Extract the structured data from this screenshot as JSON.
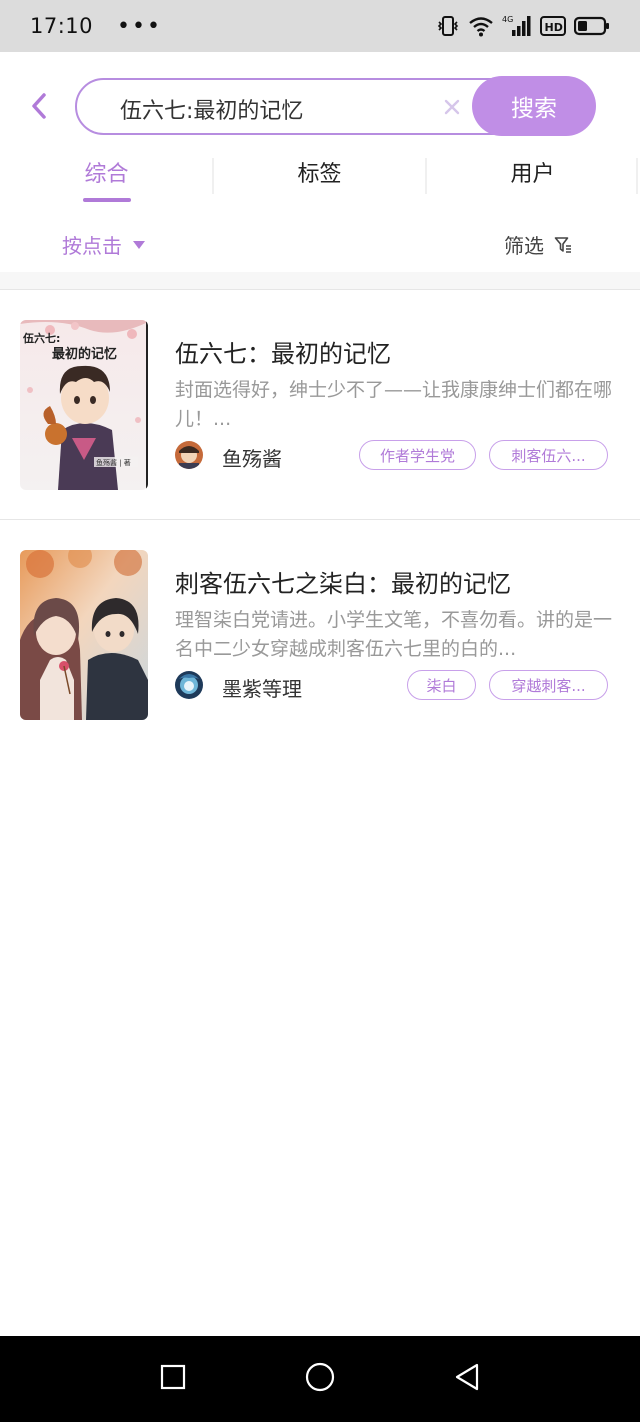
{
  "status_bar": {
    "time": "17:10",
    "dots": "•••",
    "network_label": "4G",
    "hd_label": "HD"
  },
  "search": {
    "query": "伍六七:最初的记忆",
    "button_label": "搜索"
  },
  "tabs": [
    {
      "label": "综合",
      "active": true
    },
    {
      "label": "标签",
      "active": false
    },
    {
      "label": "用户",
      "active": false
    }
  ],
  "filter": {
    "sort_label": "按点击",
    "filter_label": "筛选"
  },
  "results": [
    {
      "title": "伍六七：最初的记忆",
      "description": "封面选得好，绅士少不了——让我康康绅士们都在哪儿！...",
      "author": "鱼殇酱",
      "tags": [
        "作者学生党",
        "刺客伍六..."
      ],
      "cover_text_title": "伍六七：最初的记忆",
      "cover_text_author": "鱼殇酱 | 著"
    },
    {
      "title": "刺客伍六七之柒白：最初的记忆",
      "description": "理智柒白党请进。小学生文笔，不喜勿看。讲的是一名中二少女穿越成刺客伍六七里的白的...",
      "author": "墨紫等理",
      "tags": [
        "柒白",
        "穿越刺客..."
      ]
    }
  ],
  "colors": {
    "accent": "#b07ad8",
    "search_button": "#c08ee6",
    "status_bar": "#dcdcdc",
    "nav_bar": "#000000"
  }
}
